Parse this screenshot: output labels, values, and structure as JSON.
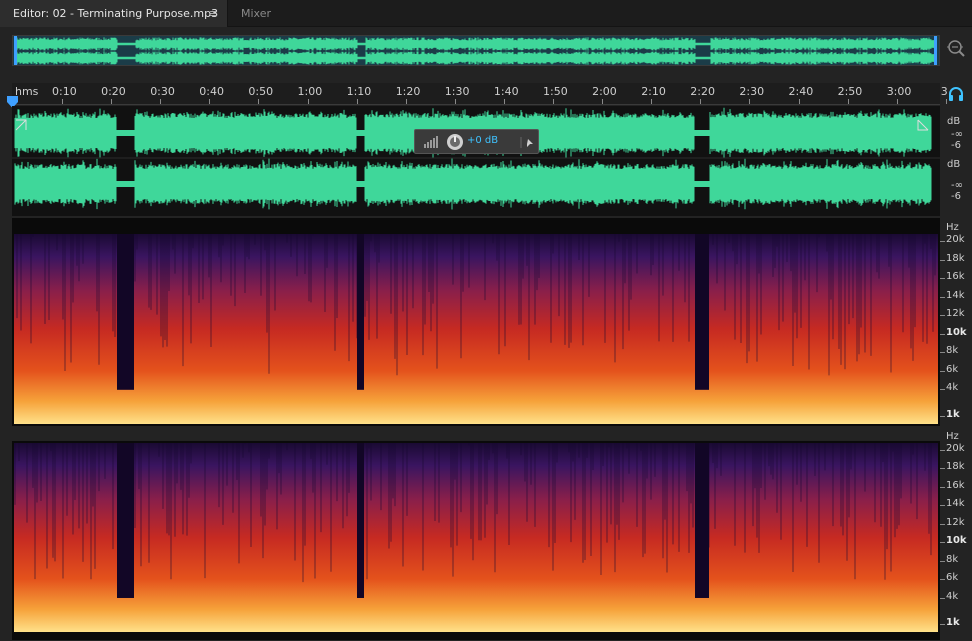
{
  "tabs": {
    "editor_label": "Editor: 02 - Terminating Purpose.mp3",
    "editor_menu": "≡",
    "mixer_label": "Mixer"
  },
  "ruler": {
    "unit": "hms",
    "ticks": [
      "0:10",
      "0:20",
      "0:30",
      "0:40",
      "0:50",
      "1:00",
      "1:10",
      "1:20",
      "1:30",
      "1:40",
      "1:50",
      "2:00",
      "2:10",
      "2:20",
      "2:30",
      "2:40",
      "2:50",
      "3:00",
      "3"
    ]
  },
  "hud": {
    "gain_label": "+0 dB"
  },
  "channels": [
    {
      "db_label": "dB",
      "inf_label": "-∞",
      "minus6_label": "-6"
    },
    {
      "db_label": "dB",
      "inf_label": "-∞",
      "minus6_label": "-6"
    }
  ],
  "spectral": {
    "unit": "Hz",
    "labels": [
      "20k",
      "18k",
      "16k",
      "14k",
      "12k",
      "10k",
      "8k",
      "6k",
      "4k",
      "1k"
    ]
  },
  "colors": {
    "waveform": "#3fd79a",
    "accent": "#3fc3ff",
    "spec_low": "#ffd27a",
    "spec_mid": "#e0341e",
    "spec_high": "#2a0e4a"
  },
  "icons": {
    "zoom": "zoom-magnifier-icon",
    "headphones": "headphones-icon",
    "knob": "volume-knob-icon",
    "pin": "pin-icon",
    "meter": "level-meter-icon"
  }
}
